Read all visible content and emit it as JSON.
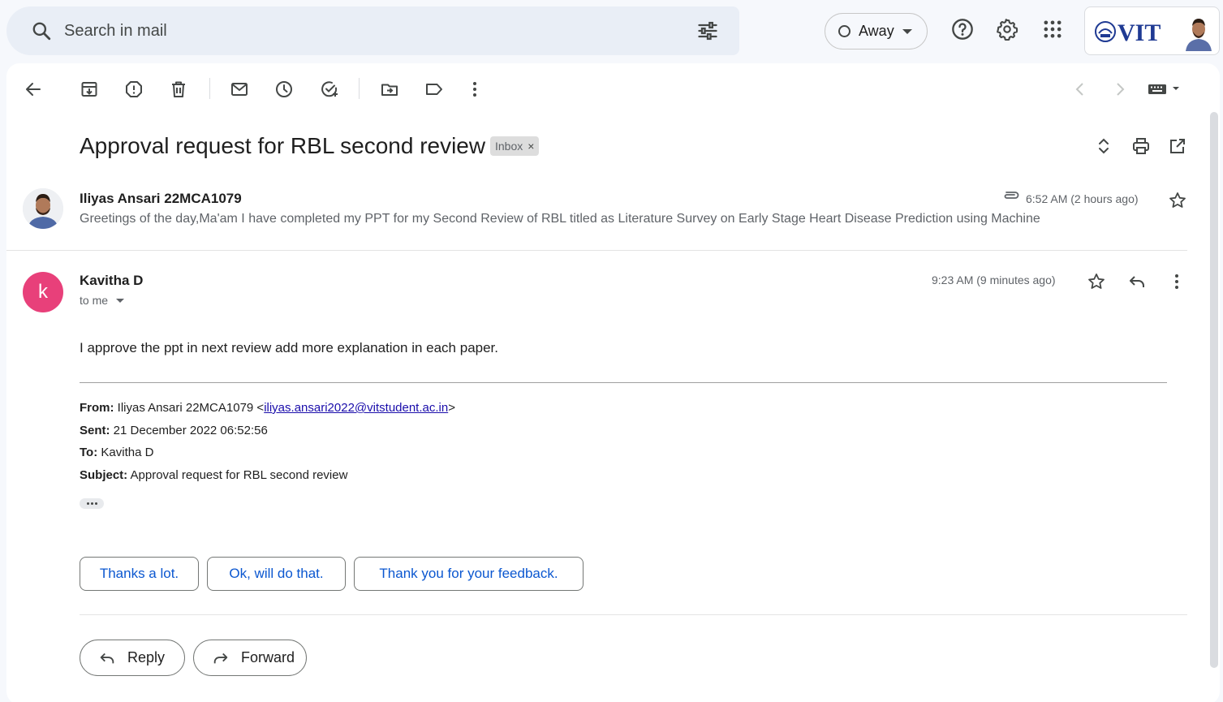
{
  "search": {
    "placeholder": "Search in mail"
  },
  "status": {
    "label": "Away"
  },
  "account": {
    "logo_text": "VIT"
  },
  "toolbar": {
    "icons": [
      "back-arrow-icon",
      "archive-icon",
      "report-spam-icon",
      "delete-icon",
      "mark-unread-icon",
      "snooze-icon",
      "add-task-icon",
      "move-to-icon",
      "label-icon",
      "more-vert-icon",
      "newer-icon",
      "older-icon",
      "keyboard-icon"
    ]
  },
  "thread": {
    "subject": "Approval request for RBL second review",
    "label_chip": "Inbox",
    "chip_close": "×"
  },
  "collapsed_message": {
    "sender": "Iliyas Ansari 22MCA1079",
    "time": "6:52 AM (2 hours ago)",
    "snippet": "Greetings of the day,Ma'am I have completed my PPT for my Second Review of RBL titled as Literature Survey on Early Stage Heart Disease Prediction using Machine"
  },
  "open_message": {
    "avatar_letter": "k",
    "sender": "Kavitha D",
    "to": "to me",
    "time": "9:23 AM (9 minutes ago)",
    "body": "I  approve the ppt in next review add more explanation in each paper.",
    "quoted": {
      "from_label": "From:",
      "from_name": " Iliyas Ansari 22MCA1079 <",
      "from_email": "iliyas.ansari2022@vitstudent.ac.in",
      "from_close": ">",
      "sent_label": "Sent:",
      "sent_value": " 21 December 2022 06:52:56",
      "to_label": "To:",
      "to_value": " Kavitha D",
      "subject_label": "Subject:",
      "subject_value": " Approval request for RBL second review"
    }
  },
  "smart_replies": [
    "Thanks a lot.",
    "Ok, will do that.",
    "Thank you for your feedback."
  ],
  "actions": {
    "reply": "Reply",
    "forward": "Forward"
  },
  "colors": {
    "avatar_k": "#e8407a",
    "smart_reply_text": "#0b57d0",
    "background": "#f6f8fc"
  }
}
